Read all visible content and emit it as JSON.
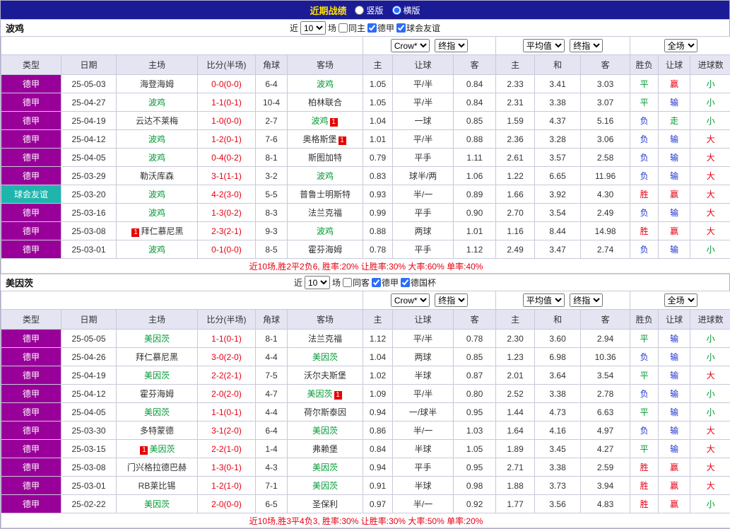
{
  "page": {
    "title_bar": {
      "title": "近期战绩",
      "radios": [
        {
          "label": "竖版",
          "checked": false
        },
        {
          "label": "横版",
          "checked": true
        }
      ]
    }
  },
  "columns": [
    "类型",
    "日期",
    "主场",
    "比分(半场)",
    "角球",
    "客场",
    "主",
    "让球",
    "客",
    "主",
    "和",
    "客",
    "胜负",
    "让球",
    "进球数"
  ],
  "dropdown_row": {
    "asia_source": "Crow*",
    "asia_type": "终指",
    "europe_source": "平均值",
    "europe_type": "终指",
    "scope": "全场"
  },
  "color_map": {
    "胜": "red",
    "平": "green",
    "负": "blue",
    "赢": "red",
    "输": "blue",
    "走": "green",
    "大": "red",
    "小": "green"
  },
  "colors": {
    "red": "#e60012",
    "blue": "#1d34cf",
    "green": "#009933",
    "league_bg": "#990099",
    "friendly_bg": "#1fb5ad",
    "accent_bar": "#1b1b96",
    "title_text": "#ffe100"
  },
  "sections": [
    {
      "team": "波鸡",
      "filter": {
        "near_label": "近",
        "count": "10",
        "games_label": "场",
        "checkboxes": [
          {
            "label": "同主",
            "checked": false
          },
          {
            "label": "德甲",
            "checked": true
          },
          {
            "label": "球会友谊",
            "checked": true
          }
        ]
      },
      "rows": [
        {
          "type": "德甲",
          "friendly": false,
          "date": "25-05-03",
          "home": {
            "name": "海登海姆",
            "focus": false,
            "badge": null,
            "badge_pos": null
          },
          "score": "0-0(0-0)",
          "corner": "6-4",
          "away": {
            "name": "波鸡",
            "focus": true,
            "badge": null,
            "badge_pos": null
          },
          "asia": [
            "1.05",
            "平/半",
            "0.84"
          ],
          "europe": [
            "2.33",
            "3.41",
            "3.03"
          ],
          "result": "平",
          "hcap": "赢",
          "goals": "小"
        },
        {
          "type": "德甲",
          "friendly": false,
          "date": "25-04-27",
          "home": {
            "name": "波鸡",
            "focus": true,
            "badge": null,
            "badge_pos": null
          },
          "score": "1-1(0-1)",
          "corner": "10-4",
          "away": {
            "name": "柏林联合",
            "focus": false,
            "badge": null,
            "badge_pos": null
          },
          "asia": [
            "1.05",
            "平/半",
            "0.84"
          ],
          "europe": [
            "2.31",
            "3.38",
            "3.07"
          ],
          "result": "平",
          "hcap": "输",
          "goals": "小"
        },
        {
          "type": "德甲",
          "friendly": false,
          "date": "25-04-19",
          "home": {
            "name": "云达不莱梅",
            "focus": false,
            "badge": null,
            "badge_pos": null
          },
          "score": "1-0(0-0)",
          "corner": "2-7",
          "away": {
            "name": "波鸡",
            "focus": true,
            "badge": "1",
            "badge_pos": "after"
          },
          "asia": [
            "1.04",
            "一球",
            "0.85"
          ],
          "europe": [
            "1.59",
            "4.37",
            "5.16"
          ],
          "result": "负",
          "hcap": "走",
          "goals": "小"
        },
        {
          "type": "德甲",
          "friendly": false,
          "date": "25-04-12",
          "home": {
            "name": "波鸡",
            "focus": true,
            "badge": null,
            "badge_pos": null
          },
          "score": "1-2(0-1)",
          "corner": "7-6",
          "away": {
            "name": "奥格斯堡",
            "focus": false,
            "badge": "1",
            "badge_pos": "after"
          },
          "asia": [
            "1.01",
            "平/半",
            "0.88"
          ],
          "europe": [
            "2.36",
            "3.28",
            "3.06"
          ],
          "result": "负",
          "hcap": "输",
          "goals": "大"
        },
        {
          "type": "德甲",
          "friendly": false,
          "date": "25-04-05",
          "home": {
            "name": "波鸡",
            "focus": true,
            "badge": null,
            "badge_pos": null
          },
          "score": "0-4(0-2)",
          "corner": "8-1",
          "away": {
            "name": "斯图加特",
            "focus": false,
            "badge": null,
            "badge_pos": null
          },
          "asia": [
            "0.79",
            "平手",
            "1.11"
          ],
          "europe": [
            "2.61",
            "3.57",
            "2.58"
          ],
          "result": "负",
          "hcap": "输",
          "goals": "大"
        },
        {
          "type": "德甲",
          "friendly": false,
          "date": "25-03-29",
          "home": {
            "name": "勒沃库森",
            "focus": false,
            "badge": null,
            "badge_pos": null
          },
          "score": "3-1(1-1)",
          "corner": "3-2",
          "away": {
            "name": "波鸡",
            "focus": true,
            "badge": null,
            "badge_pos": null
          },
          "asia": [
            "0.83",
            "球半/两",
            "1.06"
          ],
          "europe": [
            "1.22",
            "6.65",
            "11.96"
          ],
          "result": "负",
          "hcap": "输",
          "goals": "大"
        },
        {
          "type": "球会友谊",
          "friendly": true,
          "date": "25-03-20",
          "home": {
            "name": "波鸡",
            "focus": true,
            "badge": null,
            "badge_pos": null
          },
          "score": "4-2(3-0)",
          "corner": "5-5",
          "away": {
            "name": "普鲁士明斯特",
            "focus": false,
            "badge": null,
            "badge_pos": null
          },
          "asia": [
            "0.93",
            "半/一",
            "0.89"
          ],
          "europe": [
            "1.66",
            "3.92",
            "4.30"
          ],
          "result": "胜",
          "hcap": "赢",
          "goals": "大"
        },
        {
          "type": "德甲",
          "friendly": false,
          "date": "25-03-16",
          "home": {
            "name": "波鸡",
            "focus": true,
            "badge": null,
            "badge_pos": null
          },
          "score": "1-3(0-2)",
          "corner": "8-3",
          "away": {
            "name": "法兰克福",
            "focus": false,
            "badge": null,
            "badge_pos": null
          },
          "asia": [
            "0.99",
            "平手",
            "0.90"
          ],
          "europe": [
            "2.70",
            "3.54",
            "2.49"
          ],
          "result": "负",
          "hcap": "输",
          "goals": "大"
        },
        {
          "type": "德甲",
          "friendly": false,
          "date": "25-03-08",
          "home": {
            "name": "拜仁慕尼黑",
            "focus": false,
            "badge": "1",
            "badge_pos": "before"
          },
          "score": "2-3(2-1)",
          "corner": "9-3",
          "away": {
            "name": "波鸡",
            "focus": true,
            "badge": null,
            "badge_pos": null
          },
          "asia": [
            "0.88",
            "两球",
            "1.01"
          ],
          "europe": [
            "1.16",
            "8.44",
            "14.98"
          ],
          "result": "胜",
          "hcap": "赢",
          "goals": "大"
        },
        {
          "type": "德甲",
          "friendly": false,
          "date": "25-03-01",
          "home": {
            "name": "波鸡",
            "focus": true,
            "badge": null,
            "badge_pos": null
          },
          "score": "0-1(0-0)",
          "corner": "8-5",
          "away": {
            "name": "霍芬海姆",
            "focus": false,
            "badge": null,
            "badge_pos": null
          },
          "asia": [
            "0.78",
            "平手",
            "1.12"
          ],
          "europe": [
            "2.49",
            "3.47",
            "2.74"
          ],
          "result": "负",
          "hcap": "输",
          "goals": "小"
        }
      ],
      "summary": "近10场,胜2平2负6, 胜率:20% 让胜率:30% 大率:60% 单率:40%"
    },
    {
      "team": "美因茨",
      "filter": {
        "near_label": "近",
        "count": "10",
        "games_label": "场",
        "checkboxes": [
          {
            "label": "同客",
            "checked": false
          },
          {
            "label": "德甲",
            "checked": true
          },
          {
            "label": "德国杯",
            "checked": true
          }
        ]
      },
      "rows": [
        {
          "type": "德甲",
          "friendly": false,
          "date": "25-05-05",
          "home": {
            "name": "美因茨",
            "focus": true,
            "badge": null,
            "badge_pos": null
          },
          "score": "1-1(0-1)",
          "corner": "8-1",
          "away": {
            "name": "法兰克福",
            "focus": false,
            "badge": null,
            "badge_pos": null
          },
          "asia": [
            "1.12",
            "平/半",
            "0.78"
          ],
          "europe": [
            "2.30",
            "3.60",
            "2.94"
          ],
          "result": "平",
          "hcap": "输",
          "goals": "小"
        },
        {
          "type": "德甲",
          "friendly": false,
          "date": "25-04-26",
          "home": {
            "name": "拜仁慕尼黑",
            "focus": false,
            "badge": null,
            "badge_pos": null
          },
          "score": "3-0(2-0)",
          "corner": "4-4",
          "away": {
            "name": "美因茨",
            "focus": true,
            "badge": null,
            "badge_pos": null
          },
          "asia": [
            "1.04",
            "两球",
            "0.85"
          ],
          "europe": [
            "1.23",
            "6.98",
            "10.36"
          ],
          "result": "负",
          "hcap": "输",
          "goals": "小"
        },
        {
          "type": "德甲",
          "friendly": false,
          "date": "25-04-19",
          "home": {
            "name": "美因茨",
            "focus": true,
            "badge": null,
            "badge_pos": null
          },
          "score": "2-2(2-1)",
          "corner": "7-5",
          "away": {
            "name": "沃尔夫斯堡",
            "focus": false,
            "badge": null,
            "badge_pos": null
          },
          "asia": [
            "1.02",
            "半球",
            "0.87"
          ],
          "europe": [
            "2.01",
            "3.64",
            "3.54"
          ],
          "result": "平",
          "hcap": "输",
          "goals": "大"
        },
        {
          "type": "德甲",
          "friendly": false,
          "date": "25-04-12",
          "home": {
            "name": "霍芬海姆",
            "focus": false,
            "badge": null,
            "badge_pos": null
          },
          "score": "2-0(2-0)",
          "corner": "4-7",
          "away": {
            "name": "美因茨",
            "focus": true,
            "badge": "1",
            "badge_pos": "after"
          },
          "asia": [
            "1.09",
            "平/半",
            "0.80"
          ],
          "europe": [
            "2.52",
            "3.38",
            "2.78"
          ],
          "result": "负",
          "hcap": "输",
          "goals": "小"
        },
        {
          "type": "德甲",
          "friendly": false,
          "date": "25-04-05",
          "home": {
            "name": "美因茨",
            "focus": true,
            "badge": null,
            "badge_pos": null
          },
          "score": "1-1(0-1)",
          "corner": "4-4",
          "away": {
            "name": "荷尔斯泰因",
            "focus": false,
            "badge": null,
            "badge_pos": null
          },
          "asia": [
            "0.94",
            "一/球半",
            "0.95"
          ],
          "europe": [
            "1.44",
            "4.73",
            "6.63"
          ],
          "result": "平",
          "hcap": "输",
          "goals": "小"
        },
        {
          "type": "德甲",
          "friendly": false,
          "date": "25-03-30",
          "home": {
            "name": "多特蒙德",
            "focus": false,
            "badge": null,
            "badge_pos": null
          },
          "score": "3-1(2-0)",
          "corner": "6-4",
          "away": {
            "name": "美因茨",
            "focus": true,
            "badge": null,
            "badge_pos": null
          },
          "asia": [
            "0.86",
            "半/一",
            "1.03"
          ],
          "europe": [
            "1.64",
            "4.16",
            "4.97"
          ],
          "result": "负",
          "hcap": "输",
          "goals": "大"
        },
        {
          "type": "德甲",
          "friendly": false,
          "date": "25-03-15",
          "home": {
            "name": "美因茨",
            "focus": true,
            "badge": "1",
            "badge_pos": "before"
          },
          "score": "2-2(1-0)",
          "corner": "1-4",
          "away": {
            "name": "弗赖堡",
            "focus": false,
            "badge": null,
            "badge_pos": null
          },
          "asia": [
            "0.84",
            "半球",
            "1.05"
          ],
          "europe": [
            "1.89",
            "3.45",
            "4.27"
          ],
          "result": "平",
          "hcap": "输",
          "goals": "大"
        },
        {
          "type": "德甲",
          "friendly": false,
          "date": "25-03-08",
          "home": {
            "name": "门兴格拉德巴赫",
            "focus": false,
            "badge": null,
            "badge_pos": null
          },
          "score": "1-3(0-1)",
          "corner": "4-3",
          "away": {
            "name": "美因茨",
            "focus": true,
            "badge": null,
            "badge_pos": null
          },
          "asia": [
            "0.94",
            "平手",
            "0.95"
          ],
          "europe": [
            "2.71",
            "3.38",
            "2.59"
          ],
          "result": "胜",
          "hcap": "赢",
          "goals": "大"
        },
        {
          "type": "德甲",
          "friendly": false,
          "date": "25-03-01",
          "home": {
            "name": "RB莱比锡",
            "focus": false,
            "badge": null,
            "badge_pos": null
          },
          "score": "1-2(1-0)",
          "corner": "7-1",
          "away": {
            "name": "美因茨",
            "focus": true,
            "badge": null,
            "badge_pos": null
          },
          "asia": [
            "0.91",
            "半球",
            "0.98"
          ],
          "europe": [
            "1.88",
            "3.73",
            "3.94"
          ],
          "result": "胜",
          "hcap": "赢",
          "goals": "大"
        },
        {
          "type": "德甲",
          "friendly": false,
          "date": "25-02-22",
          "home": {
            "name": "美因茨",
            "focus": true,
            "badge": null,
            "badge_pos": null
          },
          "score": "2-0(0-0)",
          "corner": "6-5",
          "away": {
            "name": "圣保利",
            "focus": false,
            "badge": null,
            "badge_pos": null
          },
          "asia": [
            "0.97",
            "半/一",
            "0.92"
          ],
          "europe": [
            "1.77",
            "3.56",
            "4.83"
          ],
          "result": "胜",
          "hcap": "赢",
          "goals": "小"
        }
      ],
      "summary": "近10场,胜3平4负3, 胜率:30% 让胜率:30% 大率:50% 单率:20%"
    }
  ]
}
